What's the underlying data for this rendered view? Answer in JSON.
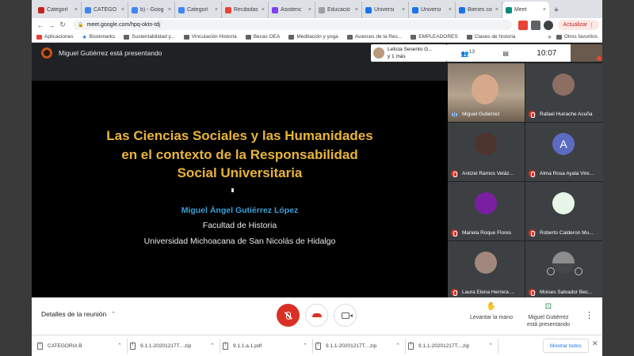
{
  "browser": {
    "tabs": [
      {
        "label": "Categorí",
        "color": "#c5221f"
      },
      {
        "label": "CATEGO",
        "color": "#4285f4"
      },
      {
        "label": "b) - Goog",
        "color": "#4285f4"
      },
      {
        "label": "Categorí",
        "color": "#4285f4"
      },
      {
        "label": "Recibidas",
        "color": "#ea4335"
      },
      {
        "label": "Asistenc",
        "color": "#7e3ff2"
      },
      {
        "label": "Educació",
        "color": "#9aa0a6"
      },
      {
        "label": "Universi",
        "color": "#1a73e8"
      },
      {
        "label": "Universi",
        "color": "#1a73e8"
      },
      {
        "label": "Bienes co",
        "color": "#1a73e8"
      },
      {
        "label": "Meet",
        "color": "#00897b"
      }
    ],
    "url": "meet.google.com/hpq-oktn-tdj",
    "update_label": "Actualizar",
    "bookmarks": [
      "Aplicaciones",
      "Bookmarks",
      "Sustentabilidad y...",
      "Vinculación Historia",
      "Becas OEA",
      "Meditación y yoga",
      "Avances de la Res...",
      "EMPLEADORES",
      "Clases de historia"
    ],
    "bookmarks_more": "»",
    "other_bookmarks": "Otros favoritos"
  },
  "meet": {
    "presenting_text": "Miguel Gutiérrez está presentando",
    "speaker_chip": {
      "line1": "Leticia Sesento G...",
      "line2": "y 1 más"
    },
    "participant_count": "13",
    "clock": "10:07",
    "self_badge": "5",
    "slide": {
      "title_line1": "Las Ciencias Sociales y las Humanidades",
      "title_line2": "en el contexto de la Responsabilidad",
      "title_line3": "Social Universitaria",
      "author": "Miguel Ángel Gutiérrez López",
      "faculty": "Facultad de Historia",
      "university": "Universidad Michoacana de San Nicolás de Hidalgo"
    },
    "participants": [
      {
        "name": "Miguel Gutiérrez",
        "state": "talking",
        "avatar": "#d7a98c"
      },
      {
        "name": "Rafael Huirache Acuña",
        "state": "muted",
        "avatar": "#8d6e63"
      },
      {
        "name": "Anitzel Ramos Veláz...",
        "state": "muted",
        "avatar": "#4e342e"
      },
      {
        "name": "Alma Rosa Ayala Vire...",
        "state": "muted",
        "avatar": "#5c6bc0",
        "letter": "A"
      },
      {
        "name": "Mariela Roque Flores",
        "state": "muted",
        "avatar": "#7b1fa2"
      },
      {
        "name": "Roberto Calderon Mu...",
        "state": "muted",
        "avatar": "#e8f5e9"
      },
      {
        "name": "Laura Elena Herrera ...",
        "state": "muted",
        "avatar": "#a1887f"
      },
      {
        "name": "Moises Salvador Bec...",
        "state": "muted",
        "avatar": "#8d8d8d"
      }
    ],
    "controls": {
      "meeting_details": "Detalles de la reunión",
      "raise_hand": "Levantar la mano",
      "present_now_line1": "Miguel Gutiérrez",
      "present_now_line2": "está presentando"
    }
  },
  "downloads": {
    "items": [
      "CATEGORIA B",
      "9.1.1-20201217T....zip",
      "9.1.1.a.1.pdf",
      "9.1.1-20201217T....zip",
      "9.1.1-20201217T....zip"
    ],
    "show_all": "Mostrar todos"
  }
}
